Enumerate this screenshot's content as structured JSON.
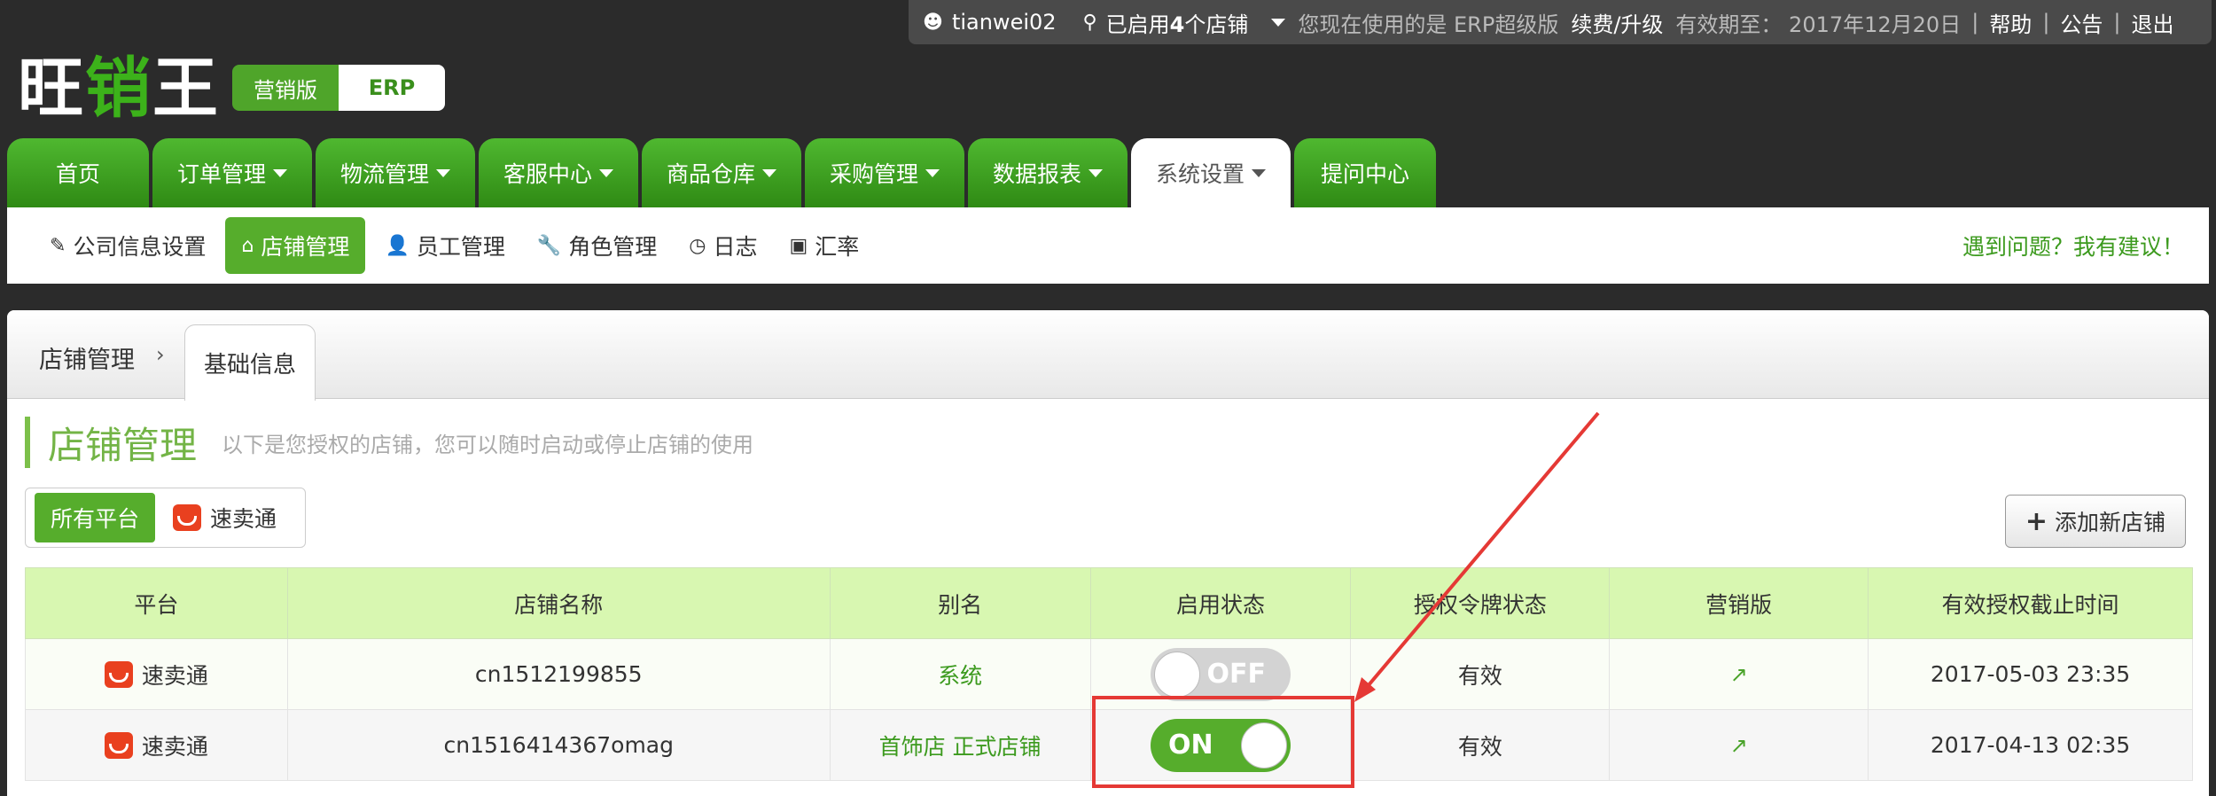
{
  "userbar": {
    "username": "tianwei02",
    "shops_prefix": "已启用",
    "shops_count": "4",
    "shops_suffix": "个店铺",
    "version_text": "您现在使用的是 ERP超级版",
    "renew": "续费/升级",
    "expiry": "有效期至： 2017年12月20日",
    "help": "帮助",
    "notice": "公告",
    "logout": "退出"
  },
  "logo": {
    "part1": "旺",
    "part2": "销",
    "part3": "王"
  },
  "edition": {
    "marketing": "营销版",
    "erp": "ERP"
  },
  "mainnav": [
    {
      "label": "首页",
      "caret": false,
      "active": false,
      "width": 160
    },
    {
      "label": "订单管理",
      "caret": true,
      "active": false,
      "width": 180
    },
    {
      "label": "物流管理",
      "caret": true,
      "active": false,
      "width": 180
    },
    {
      "label": "客服中心",
      "caret": true,
      "active": false,
      "width": 180
    },
    {
      "label": "商品仓库",
      "caret": true,
      "active": false,
      "width": 180
    },
    {
      "label": "采购管理",
      "caret": true,
      "active": false,
      "width": 180
    },
    {
      "label": "数据报表",
      "caret": true,
      "active": false,
      "width": 180
    },
    {
      "label": "系统设置",
      "caret": true,
      "active": true,
      "width": 180
    },
    {
      "label": "提问中心",
      "caret": false,
      "active": false,
      "width": 160
    }
  ],
  "subnav": {
    "items": [
      {
        "label": "公司信息设置",
        "icon": "✎"
      },
      {
        "label": "店铺管理",
        "icon": "⌂"
      },
      {
        "label": "员工管理",
        "icon": "👤"
      },
      {
        "label": "角色管理",
        "icon": "🔧"
      },
      {
        "label": "日志",
        "icon": "◷"
      },
      {
        "label": "汇率",
        "icon": "▣"
      }
    ],
    "help": "遇到问题？我有建议！"
  },
  "breadcrumb": {
    "root": "店铺管理",
    "current": "基础信息"
  },
  "page": {
    "title": "店铺管理",
    "desc": "以下是您授权的店铺，您可以随时启动或停止店铺的使用"
  },
  "filter": {
    "all": "所有平台",
    "aliexpress": "速卖通"
  },
  "add_button": "添加新店铺",
  "table": {
    "headers": [
      "平台",
      "店铺名称",
      "别名",
      "启用状态",
      "授权令牌状态",
      "营销版",
      "有效授权截止时间"
    ],
    "rows": [
      {
        "platform": "速卖通",
        "shop": "cn1512199855",
        "alias": "系统",
        "state": "OFF",
        "token": "有效",
        "expiry": "2017-05-03 23:35"
      },
      {
        "platform": "速卖通",
        "shop": "cn1516414367omag",
        "alias": "首饰店 正式店铺",
        "state": "ON",
        "token": "有效",
        "expiry": "2017-04-13 02:35"
      }
    ]
  },
  "colors": {
    "green": "#56ad2c",
    "nav_green": "#3a9a1c",
    "highlight_red": "#e53935"
  }
}
